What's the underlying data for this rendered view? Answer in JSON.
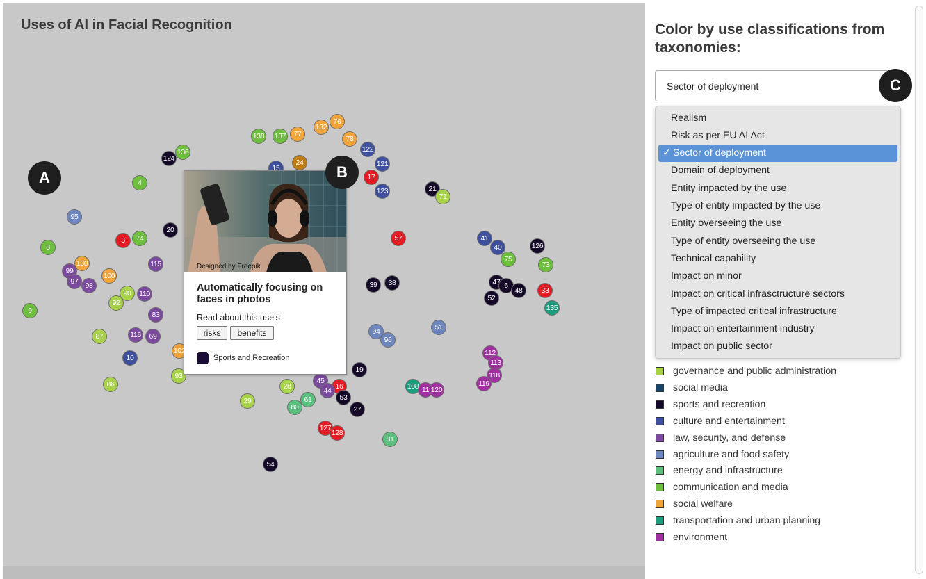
{
  "map": {
    "title": "Uses of AI in Facial Recognition"
  },
  "badges": [
    "A",
    "B",
    "C"
  ],
  "colors": {
    "communication": "#6fbf3f",
    "culture": "#3e4f9e",
    "agriculture": "#6d86c0",
    "law": "#7b4a9e",
    "social_welfare": "#f0a43a",
    "sports": "#140a28",
    "crimson": "#e31b23",
    "governance": "#a8d24a",
    "energy": "#5bbf7e",
    "transport": "#1a9e7e",
    "environment": "#a030a0",
    "amber": "#c07c14"
  },
  "nodes": [
    {
      "label": "138",
      "color": "#6fbf3f"
    },
    {
      "label": "137",
      "color": "#6fbf3f"
    },
    {
      "label": "77",
      "color": "#f0a43a"
    },
    {
      "label": "132",
      "color": "#f0a43a"
    },
    {
      "label": "76",
      "color": "#f0a43a"
    },
    {
      "label": "78",
      "color": "#f0a43a"
    },
    {
      "label": "122",
      "color": "#3e4f9e"
    },
    {
      "label": "124",
      "color": "#140a28"
    },
    {
      "label": "136",
      "color": "#6fbf3f"
    },
    {
      "label": "15",
      "color": "#3e4f9e"
    },
    {
      "label": "24",
      "color": "#c07c14"
    },
    {
      "label": "121",
      "color": "#3e4f9e"
    },
    {
      "label": "17",
      "color": "#e31b23"
    },
    {
      "label": "123",
      "color": "#3e4f9e"
    },
    {
      "label": "21",
      "color": "#140a28"
    },
    {
      "label": "71",
      "color": "#a8d24a"
    },
    {
      "label": "4",
      "color": "#6fbf3f"
    },
    {
      "label": "95",
      "color": "#6d86c0"
    },
    {
      "label": "20",
      "color": "#140a28"
    },
    {
      "label": "3",
      "color": "#e31b23"
    },
    {
      "label": "74",
      "color": "#6fbf3f"
    },
    {
      "label": "8",
      "color": "#6fbf3f"
    },
    {
      "label": "130",
      "color": "#f0a43a"
    },
    {
      "label": "115",
      "color": "#7b4a9e"
    },
    {
      "label": "99",
      "color": "#7b4a9e"
    },
    {
      "label": "97",
      "color": "#7b4a9e"
    },
    {
      "label": "98",
      "color": "#7b4a9e"
    },
    {
      "label": "100",
      "color": "#f0a43a"
    },
    {
      "label": "90",
      "color": "#a8d24a"
    },
    {
      "label": "92",
      "color": "#a8d24a"
    },
    {
      "label": "110",
      "color": "#7b4a9e"
    },
    {
      "label": "9",
      "color": "#6fbf3f"
    },
    {
      "label": "83",
      "color": "#7b4a9e"
    },
    {
      "label": "87",
      "color": "#a8d24a"
    },
    {
      "label": "116",
      "color": "#7b4a9e"
    },
    {
      "label": "69",
      "color": "#7b4a9e"
    },
    {
      "label": "102",
      "color": "#f0a43a"
    },
    {
      "label": "10",
      "color": "#3e4f9e"
    },
    {
      "label": "93",
      "color": "#a8d24a"
    },
    {
      "label": "86",
      "color": "#a8d24a"
    },
    {
      "label": "57",
      "color": "#e31b23"
    },
    {
      "label": "41",
      "color": "#3e4f9e"
    },
    {
      "label": "40",
      "color": "#3e4f9e"
    },
    {
      "label": "75",
      "color": "#6fbf3f"
    },
    {
      "label": "126",
      "color": "#140a28"
    },
    {
      "label": "73",
      "color": "#6fbf3f"
    },
    {
      "label": "39",
      "color": "#140a28"
    },
    {
      "label": "38",
      "color": "#140a28"
    },
    {
      "label": "47",
      "color": "#140a28"
    },
    {
      "label": "6",
      "color": "#140a28"
    },
    {
      "label": "48",
      "color": "#140a28"
    },
    {
      "label": "33",
      "color": "#e31b23"
    },
    {
      "label": "52",
      "color": "#140a28"
    },
    {
      "label": "135",
      "color": "#1a9e7e"
    },
    {
      "label": "94",
      "color": "#6d86c0"
    },
    {
      "label": "96",
      "color": "#6d86c0"
    },
    {
      "label": "51",
      "color": "#6d86c0"
    },
    {
      "label": "112",
      "color": "#a030a0"
    },
    {
      "label": "113",
      "color": "#a030a0"
    },
    {
      "label": "118",
      "color": "#a030a0"
    },
    {
      "label": "119",
      "color": "#a030a0"
    },
    {
      "label": "19",
      "color": "#140a28"
    },
    {
      "label": "45",
      "color": "#7b4a9e"
    },
    {
      "label": "16",
      "color": "#e31b23"
    },
    {
      "label": "44",
      "color": "#7b4a9e"
    },
    {
      "label": "28",
      "color": "#a8d24a"
    },
    {
      "label": "108",
      "color": "#1a9e7e"
    },
    {
      "label": "11",
      "color": "#a030a0"
    },
    {
      "label": "120",
      "color": "#a030a0"
    },
    {
      "label": "53",
      "color": "#140a28"
    },
    {
      "label": "27",
      "color": "#140a28"
    },
    {
      "label": "61",
      "color": "#5bbf7e"
    },
    {
      "label": "80",
      "color": "#5bbf7e"
    },
    {
      "label": "29",
      "color": "#a8d24a"
    },
    {
      "label": "127",
      "color": "#e31b23"
    },
    {
      "label": "128",
      "color": "#e31b23"
    },
    {
      "label": "81",
      "color": "#5bbf7e"
    },
    {
      "label": "54",
      "color": "#140a28"
    }
  ],
  "popup": {
    "credit": "Designed by Freepik",
    "title": "Automatically focusing on faces in photos",
    "read_about": "Read about this use's",
    "risks_label": "risks",
    "benefits_label": "benefits",
    "category": "Sports and Recreation"
  },
  "panel": {
    "title": "Color by use classifications from taxonomies:",
    "select_value": "Sector of deployment",
    "options": [
      "Realism",
      "Risk as per EU AI Act",
      "Sector of deployment",
      "Domain of deployment",
      "Entity impacted by the use",
      "Type of entity impacted by the use",
      "Entity overseeing the use",
      "Type of entity overseeing the use",
      "Technical capability",
      "Impact on minor",
      "Impact on critical infrasctructure sectors",
      "Type of impacted critical infrastructure",
      "Impact on entertainment industry",
      "Impact on public sector"
    ],
    "selected_check": "✓",
    "legend": [
      {
        "label": "governance and public administration",
        "color": "#a8d24a"
      },
      {
        "label": "social media",
        "color": "#1a4466"
      },
      {
        "label": "sports and recreation",
        "color": "#140a28"
      },
      {
        "label": "culture and entertainment",
        "color": "#3e4f9e"
      },
      {
        "label": "law, security, and defense",
        "color": "#7b4a9e"
      },
      {
        "label": "agriculture and food safety",
        "color": "#6d86c0"
      },
      {
        "label": "energy and infrastructure",
        "color": "#5bbf7e"
      },
      {
        "label": "communication and media",
        "color": "#6fbf3f"
      },
      {
        "label": "social welfare",
        "color": "#f0a43a"
      },
      {
        "label": "transportation and urban planning",
        "color": "#1a9e7e"
      },
      {
        "label": "environment",
        "color": "#a030a0"
      }
    ]
  }
}
